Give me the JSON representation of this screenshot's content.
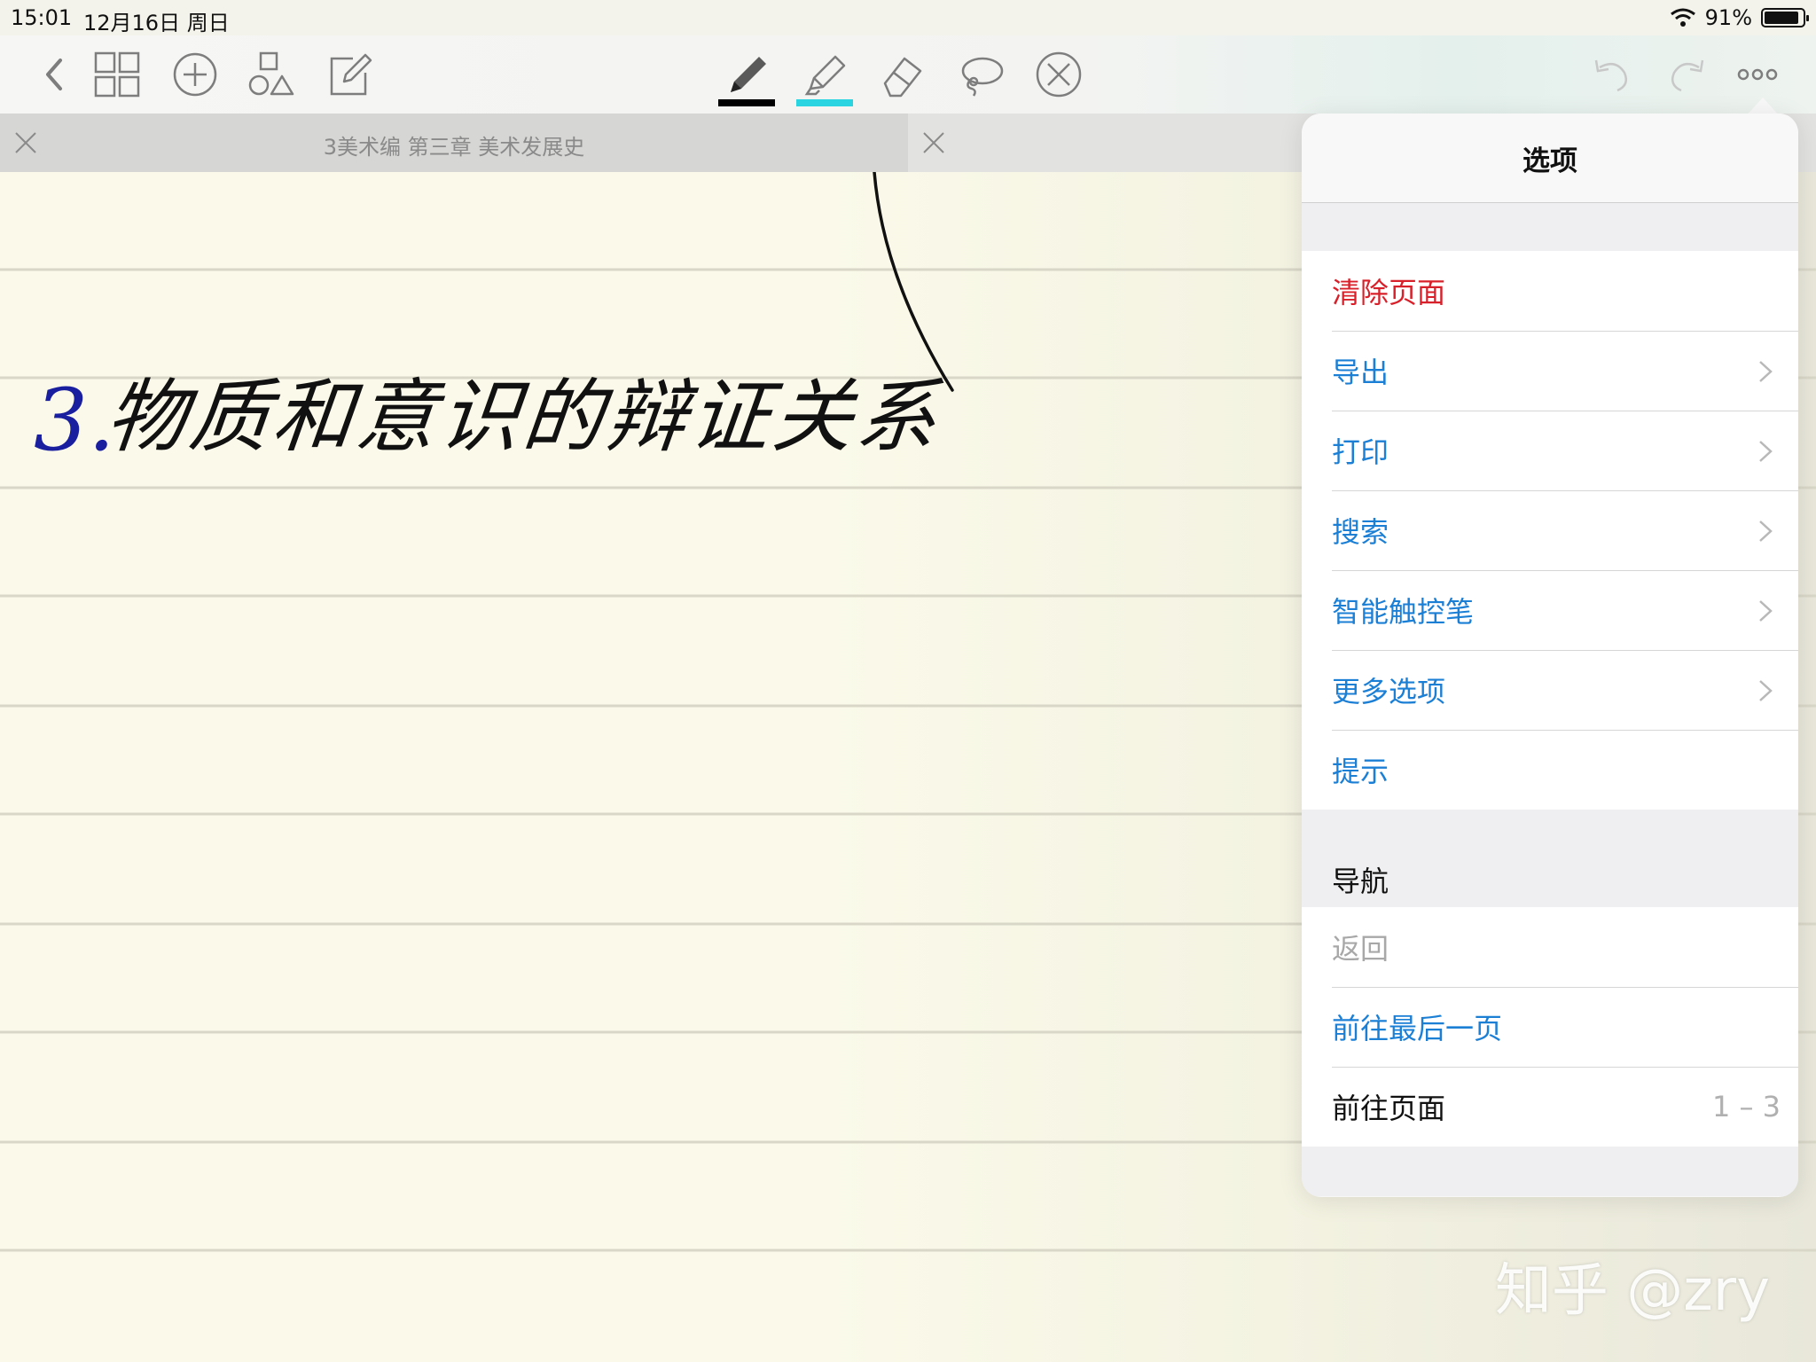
{
  "status_bar": {
    "time": "15:01",
    "date": "12月16日 周日",
    "battery": "91%",
    "battery_level": 0.91
  },
  "toolbar": {
    "left_icons": [
      "back-chevron-icon",
      "grid-icon",
      "add-circle-icon",
      "shapes-icon",
      "edit-note-icon"
    ],
    "tools": [
      {
        "icon": "pen-icon",
        "underline_color": "#000000"
      },
      {
        "icon": "highlighter-icon",
        "underline_color": "#2ad4e0"
      },
      {
        "icon": "eraser-icon"
      },
      {
        "icon": "lasso-icon"
      },
      {
        "icon": "clear-x-icon"
      }
    ],
    "right_icons": [
      "undo-icon",
      "redo-icon",
      "more-icon"
    ]
  },
  "tabs": [
    {
      "title": "3美术编 第三章 美术发展史",
      "active": true
    },
    {
      "title": "",
      "active": false
    }
  ],
  "note": {
    "number": "3.",
    "heading": "物质和意识的辩证关系",
    "number_color": "#1a1fa0",
    "ink_color": "#111111",
    "paper_color": "#fbfaea"
  },
  "popover": {
    "title": "选项",
    "items": [
      {
        "label": "清除页面",
        "style": "red",
        "chevron": false
      },
      {
        "label": "导出",
        "style": "blue",
        "chevron": true
      },
      {
        "label": "打印",
        "style": "blue",
        "chevron": true
      },
      {
        "label": "搜索",
        "style": "blue",
        "chevron": true
      },
      {
        "label": "智能触控笔",
        "style": "blue",
        "chevron": true
      },
      {
        "label": "更多选项",
        "style": "blue",
        "chevron": true
      },
      {
        "label": "提示",
        "style": "blue",
        "chevron": false
      }
    ],
    "nav_section": {
      "title": "导航",
      "items": [
        {
          "label": "返回",
          "style": "gray"
        },
        {
          "label": "前往最后一页",
          "style": "blue"
        },
        {
          "label": "前往页面",
          "style": "black",
          "value": "1 – 3"
        }
      ]
    },
    "colors": {
      "red": "#d8202a",
      "blue": "#1b7fd6"
    }
  },
  "watermark": "知乎 @zry"
}
